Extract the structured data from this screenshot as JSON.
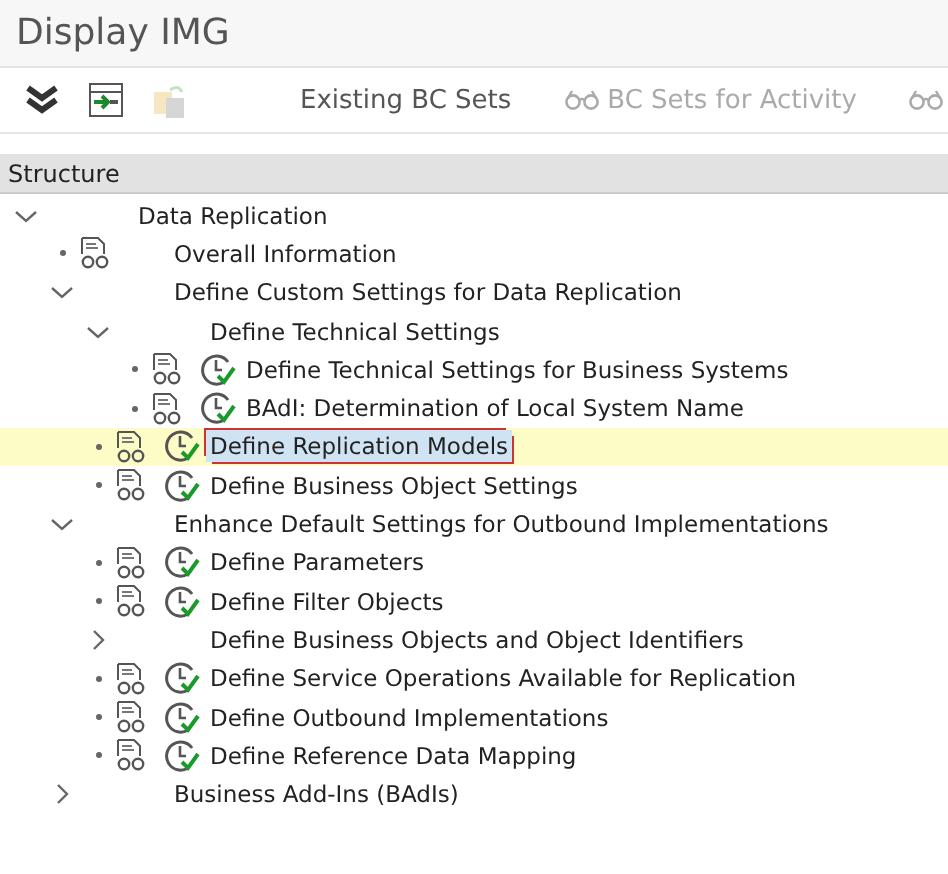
{
  "window": {
    "title": "Display IMG"
  },
  "toolbar": {
    "icon_buttons": [
      {
        "kind": "expand",
        "disabled": false
      },
      {
        "kind": "execute",
        "disabled": false
      },
      {
        "kind": "copy",
        "disabled": true
      }
    ],
    "buttons": [
      {
        "label": "Existing BC Sets",
        "glasses": false,
        "disabled": false
      },
      {
        "label": "BC Sets for Activity",
        "glasses": true,
        "disabled": true
      },
      {
        "glasses": true,
        "disabled": true
      }
    ]
  },
  "structure": {
    "header": "Structure",
    "items": [
      {
        "label": "Data Replication",
        "expanded": true,
        "documentation": false,
        "activity": false,
        "selected": false,
        "children": [
          {
            "label": "Overall Information",
            "documentation": true,
            "activity": false,
            "selected": false
          },
          {
            "label": "Define Custom Settings for Data Replication",
            "expanded": true,
            "documentation": false,
            "activity": false,
            "selected": false,
            "children": [
              {
                "label": "Define Technical Settings",
                "expanded": true,
                "documentation": false,
                "activity": false,
                "selected": false,
                "children": [
                  {
                    "label": "Define Technical Settings for Business Systems",
                    "documentation": true,
                    "activity": true,
                    "selected": false
                  },
                  {
                    "label": "BAdI: Determination of Local System Name",
                    "documentation": true,
                    "activity": true,
                    "selected": false
                  }
                ]
              },
              {
                "label": "Define Replication Models",
                "documentation": true,
                "activity": true,
                "selected": true
              },
              {
                "label": "Define Business Object Settings",
                "documentation": true,
                "activity": true,
                "selected": false
              }
            ]
          },
          {
            "label": "Enhance Default Settings for Outbound Implementations",
            "expanded": true,
            "documentation": false,
            "activity": false,
            "selected": false,
            "children": [
              {
                "label": "Define Parameters",
                "documentation": true,
                "activity": true,
                "selected": false
              },
              {
                "label": "Define Filter Objects",
                "documentation": true,
                "activity": true,
                "selected": false
              },
              {
                "label": "Define Business Objects and Object Identifiers",
                "expanded": false,
                "documentation": false,
                "activity": false,
                "selected": false
              },
              {
                "label": "Define Service Operations Available for Replication",
                "documentation": true,
                "activity": true,
                "selected": false
              },
              {
                "label": "Define Outbound Implementations",
                "documentation": true,
                "activity": true,
                "selected": false
              },
              {
                "label": "Define Reference Data Mapping",
                "documentation": true,
                "activity": true,
                "selected": false
              }
            ]
          },
          {
            "label": "Business Add-Ins (BAdIs)",
            "expanded": false,
            "documentation": false,
            "activity": false,
            "selected": false
          }
        ]
      }
    ]
  }
}
